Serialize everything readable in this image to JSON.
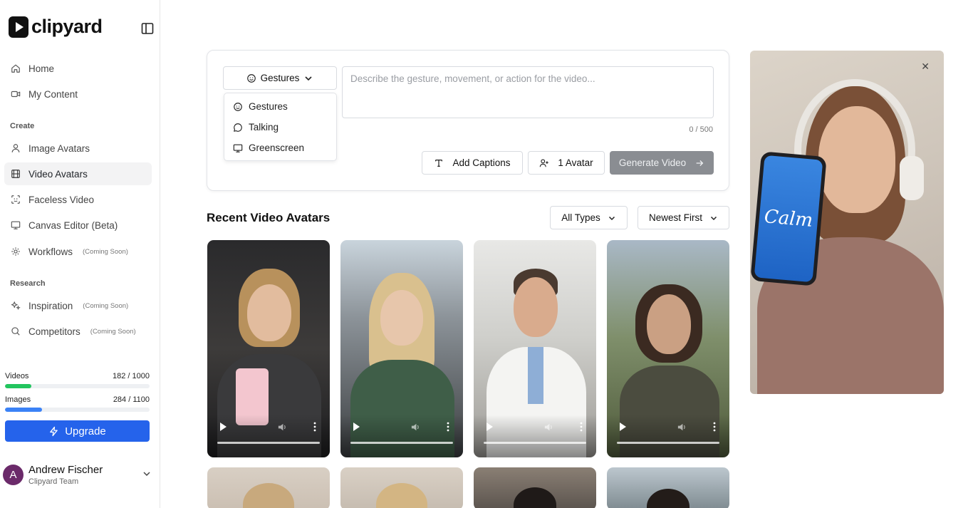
{
  "brand": {
    "name": "clipyard"
  },
  "sidebar": {
    "nav": [
      {
        "label": "Home",
        "icon": "home-icon"
      },
      {
        "label": "My Content",
        "icon": "video-camera-icon"
      }
    ],
    "create_label": "Create",
    "create_items": [
      {
        "label": "Image Avatars",
        "icon": "person-icon",
        "soon": ""
      },
      {
        "label": "Video Avatars",
        "icon": "film-icon",
        "soon": "",
        "active": true
      },
      {
        "label": "Faceless Video",
        "icon": "scan-face-icon",
        "soon": ""
      },
      {
        "label": "Canvas Editor (Beta)",
        "icon": "monitor-icon",
        "soon": ""
      },
      {
        "label": "Workflows",
        "icon": "gear-icon",
        "soon": "(Coming Soon)"
      }
    ],
    "research_label": "Research",
    "research_items": [
      {
        "label": "Inspiration",
        "icon": "sparkles-icon",
        "soon": "(Coming Soon)"
      },
      {
        "label": "Competitors",
        "icon": "search-icon",
        "soon": "(Coming Soon)"
      }
    ],
    "usage": {
      "videos_label": "Videos",
      "videos_value": "182 / 1000",
      "videos_fraction": 0.182,
      "videos_color": "#22c55e",
      "images_label": "Images",
      "images_value": "284 / 1100",
      "images_fraction": 0.258,
      "images_color": "#3b82f6"
    },
    "upgrade_label": "Upgrade",
    "user": {
      "initial": "A",
      "name": "Andrew Fischer",
      "team": "Clipyard Team"
    }
  },
  "composer": {
    "type_selected": "Gestures",
    "type_options": [
      {
        "label": "Gestures",
        "icon": "smile-icon"
      },
      {
        "label": "Talking",
        "icon": "message-circle-icon"
      },
      {
        "label": "Greenscreen",
        "icon": "monitor-icon"
      }
    ],
    "prompt_placeholder": "Describe the gesture, movement, or action for the video...",
    "counter": "0 / 500",
    "add_captions_label": "Add Captions",
    "avatar_count_label": "1 Avatar",
    "generate_label": "Generate Video"
  },
  "recent": {
    "title": "Recent Video Avatars",
    "type_filter": "All Types",
    "sort_filter": "Newest First"
  }
}
